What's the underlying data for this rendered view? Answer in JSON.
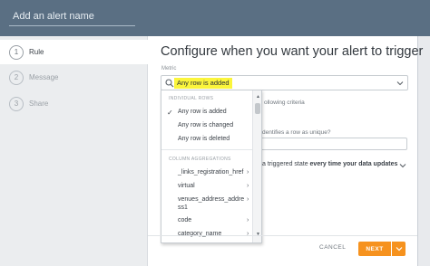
{
  "header": {
    "alert_name_placeholder": "Add an alert name"
  },
  "sidebar": {
    "steps": [
      {
        "num": "1",
        "label": "Rule"
      },
      {
        "num": "2",
        "label": "Message"
      },
      {
        "num": "3",
        "label": "Share"
      }
    ]
  },
  "main": {
    "heading": "Configure when you want your alert to trigger",
    "metric_label": "Metric",
    "metric_value": "Any row is added",
    "bg_text_1": "ollowing criteria",
    "bg_text_2": "dentifies a row as unique?",
    "bg_text_3_pre": "a triggered state ",
    "bg_text_3_bold": "every time your data updates"
  },
  "dropdown": {
    "section_individual": "INDIVIDUAL ROWS",
    "individual_items": [
      "Any row is added",
      "Any row is changed",
      "Any row is deleted"
    ],
    "selected_index": 0,
    "section_aggregations": "COLUMN AGGREGATIONS",
    "agg_items": [
      "_links_registration_href",
      "virtual",
      "venues_address_addre",
      "ss1",
      "code",
      "category_name"
    ]
  },
  "footer": {
    "cancel_label": "CANCEL",
    "next_label": "NEXT"
  },
  "colors": {
    "header": "#5a6f83",
    "accent": "#f6921e",
    "highlight": "#fbf53b"
  }
}
